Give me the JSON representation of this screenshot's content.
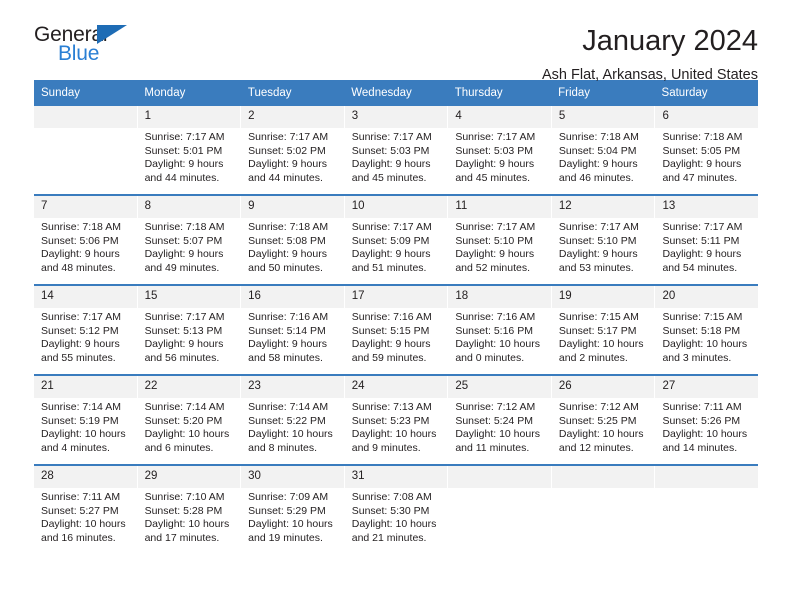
{
  "brand": {
    "name_part1": "General",
    "name_part2": "Blue",
    "triangle_color": "#1e6cb5",
    "blue_text_color": "#2a7fd4"
  },
  "header": {
    "month_title": "January 2024",
    "location": "Ash Flat, Arkansas, United States"
  },
  "theme": {
    "header_blue": "#3a7cbe",
    "daynum_band": "#f2f2f2",
    "text": "#231f20"
  },
  "calendar": {
    "weekday_headers": [
      "Sunday",
      "Monday",
      "Tuesday",
      "Wednesday",
      "Thursday",
      "Friday",
      "Saturday"
    ],
    "weeks": [
      [
        {
          "day": "",
          "sunrise": "",
          "sunset": "",
          "daylight_line1": "",
          "daylight_line2": ""
        },
        {
          "day": "1",
          "sunrise": "Sunrise: 7:17 AM",
          "sunset": "Sunset: 5:01 PM",
          "daylight_line1": "Daylight: 9 hours",
          "daylight_line2": "and 44 minutes."
        },
        {
          "day": "2",
          "sunrise": "Sunrise: 7:17 AM",
          "sunset": "Sunset: 5:02 PM",
          "daylight_line1": "Daylight: 9 hours",
          "daylight_line2": "and 44 minutes."
        },
        {
          "day": "3",
          "sunrise": "Sunrise: 7:17 AM",
          "sunset": "Sunset: 5:03 PM",
          "daylight_line1": "Daylight: 9 hours",
          "daylight_line2": "and 45 minutes."
        },
        {
          "day": "4",
          "sunrise": "Sunrise: 7:17 AM",
          "sunset": "Sunset: 5:03 PM",
          "daylight_line1": "Daylight: 9 hours",
          "daylight_line2": "and 45 minutes."
        },
        {
          "day": "5",
          "sunrise": "Sunrise: 7:18 AM",
          "sunset": "Sunset: 5:04 PM",
          "daylight_line1": "Daylight: 9 hours",
          "daylight_line2": "and 46 minutes."
        },
        {
          "day": "6",
          "sunrise": "Sunrise: 7:18 AM",
          "sunset": "Sunset: 5:05 PM",
          "daylight_line1": "Daylight: 9 hours",
          "daylight_line2": "and 47 minutes."
        }
      ],
      [
        {
          "day": "7",
          "sunrise": "Sunrise: 7:18 AM",
          "sunset": "Sunset: 5:06 PM",
          "daylight_line1": "Daylight: 9 hours",
          "daylight_line2": "and 48 minutes."
        },
        {
          "day": "8",
          "sunrise": "Sunrise: 7:18 AM",
          "sunset": "Sunset: 5:07 PM",
          "daylight_line1": "Daylight: 9 hours",
          "daylight_line2": "and 49 minutes."
        },
        {
          "day": "9",
          "sunrise": "Sunrise: 7:18 AM",
          "sunset": "Sunset: 5:08 PM",
          "daylight_line1": "Daylight: 9 hours",
          "daylight_line2": "and 50 minutes."
        },
        {
          "day": "10",
          "sunrise": "Sunrise: 7:17 AM",
          "sunset": "Sunset: 5:09 PM",
          "daylight_line1": "Daylight: 9 hours",
          "daylight_line2": "and 51 minutes."
        },
        {
          "day": "11",
          "sunrise": "Sunrise: 7:17 AM",
          "sunset": "Sunset: 5:10 PM",
          "daylight_line1": "Daylight: 9 hours",
          "daylight_line2": "and 52 minutes."
        },
        {
          "day": "12",
          "sunrise": "Sunrise: 7:17 AM",
          "sunset": "Sunset: 5:10 PM",
          "daylight_line1": "Daylight: 9 hours",
          "daylight_line2": "and 53 minutes."
        },
        {
          "day": "13",
          "sunrise": "Sunrise: 7:17 AM",
          "sunset": "Sunset: 5:11 PM",
          "daylight_line1": "Daylight: 9 hours",
          "daylight_line2": "and 54 minutes."
        }
      ],
      [
        {
          "day": "14",
          "sunrise": "Sunrise: 7:17 AM",
          "sunset": "Sunset: 5:12 PM",
          "daylight_line1": "Daylight: 9 hours",
          "daylight_line2": "and 55 minutes."
        },
        {
          "day": "15",
          "sunrise": "Sunrise: 7:17 AM",
          "sunset": "Sunset: 5:13 PM",
          "daylight_line1": "Daylight: 9 hours",
          "daylight_line2": "and 56 minutes."
        },
        {
          "day": "16",
          "sunrise": "Sunrise: 7:16 AM",
          "sunset": "Sunset: 5:14 PM",
          "daylight_line1": "Daylight: 9 hours",
          "daylight_line2": "and 58 minutes."
        },
        {
          "day": "17",
          "sunrise": "Sunrise: 7:16 AM",
          "sunset": "Sunset: 5:15 PM",
          "daylight_line1": "Daylight: 9 hours",
          "daylight_line2": "and 59 minutes."
        },
        {
          "day": "18",
          "sunrise": "Sunrise: 7:16 AM",
          "sunset": "Sunset: 5:16 PM",
          "daylight_line1": "Daylight: 10 hours",
          "daylight_line2": "and 0 minutes."
        },
        {
          "day": "19",
          "sunrise": "Sunrise: 7:15 AM",
          "sunset": "Sunset: 5:17 PM",
          "daylight_line1": "Daylight: 10 hours",
          "daylight_line2": "and 2 minutes."
        },
        {
          "day": "20",
          "sunrise": "Sunrise: 7:15 AM",
          "sunset": "Sunset: 5:18 PM",
          "daylight_line1": "Daylight: 10 hours",
          "daylight_line2": "and 3 minutes."
        }
      ],
      [
        {
          "day": "21",
          "sunrise": "Sunrise: 7:14 AM",
          "sunset": "Sunset: 5:19 PM",
          "daylight_line1": "Daylight: 10 hours",
          "daylight_line2": "and 4 minutes."
        },
        {
          "day": "22",
          "sunrise": "Sunrise: 7:14 AM",
          "sunset": "Sunset: 5:20 PM",
          "daylight_line1": "Daylight: 10 hours",
          "daylight_line2": "and 6 minutes."
        },
        {
          "day": "23",
          "sunrise": "Sunrise: 7:14 AM",
          "sunset": "Sunset: 5:22 PM",
          "daylight_line1": "Daylight: 10 hours",
          "daylight_line2": "and 8 minutes."
        },
        {
          "day": "24",
          "sunrise": "Sunrise: 7:13 AM",
          "sunset": "Sunset: 5:23 PM",
          "daylight_line1": "Daylight: 10 hours",
          "daylight_line2": "and 9 minutes."
        },
        {
          "day": "25",
          "sunrise": "Sunrise: 7:12 AM",
          "sunset": "Sunset: 5:24 PM",
          "daylight_line1": "Daylight: 10 hours",
          "daylight_line2": "and 11 minutes."
        },
        {
          "day": "26",
          "sunrise": "Sunrise: 7:12 AM",
          "sunset": "Sunset: 5:25 PM",
          "daylight_line1": "Daylight: 10 hours",
          "daylight_line2": "and 12 minutes."
        },
        {
          "day": "27",
          "sunrise": "Sunrise: 7:11 AM",
          "sunset": "Sunset: 5:26 PM",
          "daylight_line1": "Daylight: 10 hours",
          "daylight_line2": "and 14 minutes."
        }
      ],
      [
        {
          "day": "28",
          "sunrise": "Sunrise: 7:11 AM",
          "sunset": "Sunset: 5:27 PM",
          "daylight_line1": "Daylight: 10 hours",
          "daylight_line2": "and 16 minutes."
        },
        {
          "day": "29",
          "sunrise": "Sunrise: 7:10 AM",
          "sunset": "Sunset: 5:28 PM",
          "daylight_line1": "Daylight: 10 hours",
          "daylight_line2": "and 17 minutes."
        },
        {
          "day": "30",
          "sunrise": "Sunrise: 7:09 AM",
          "sunset": "Sunset: 5:29 PM",
          "daylight_line1": "Daylight: 10 hours",
          "daylight_line2": "and 19 minutes."
        },
        {
          "day": "31",
          "sunrise": "Sunrise: 7:08 AM",
          "sunset": "Sunset: 5:30 PM",
          "daylight_line1": "Daylight: 10 hours",
          "daylight_line2": "and 21 minutes."
        },
        {
          "day": "",
          "sunrise": "",
          "sunset": "",
          "daylight_line1": "",
          "daylight_line2": ""
        },
        {
          "day": "",
          "sunrise": "",
          "sunset": "",
          "daylight_line1": "",
          "daylight_line2": ""
        },
        {
          "day": "",
          "sunrise": "",
          "sunset": "",
          "daylight_line1": "",
          "daylight_line2": ""
        }
      ]
    ]
  }
}
